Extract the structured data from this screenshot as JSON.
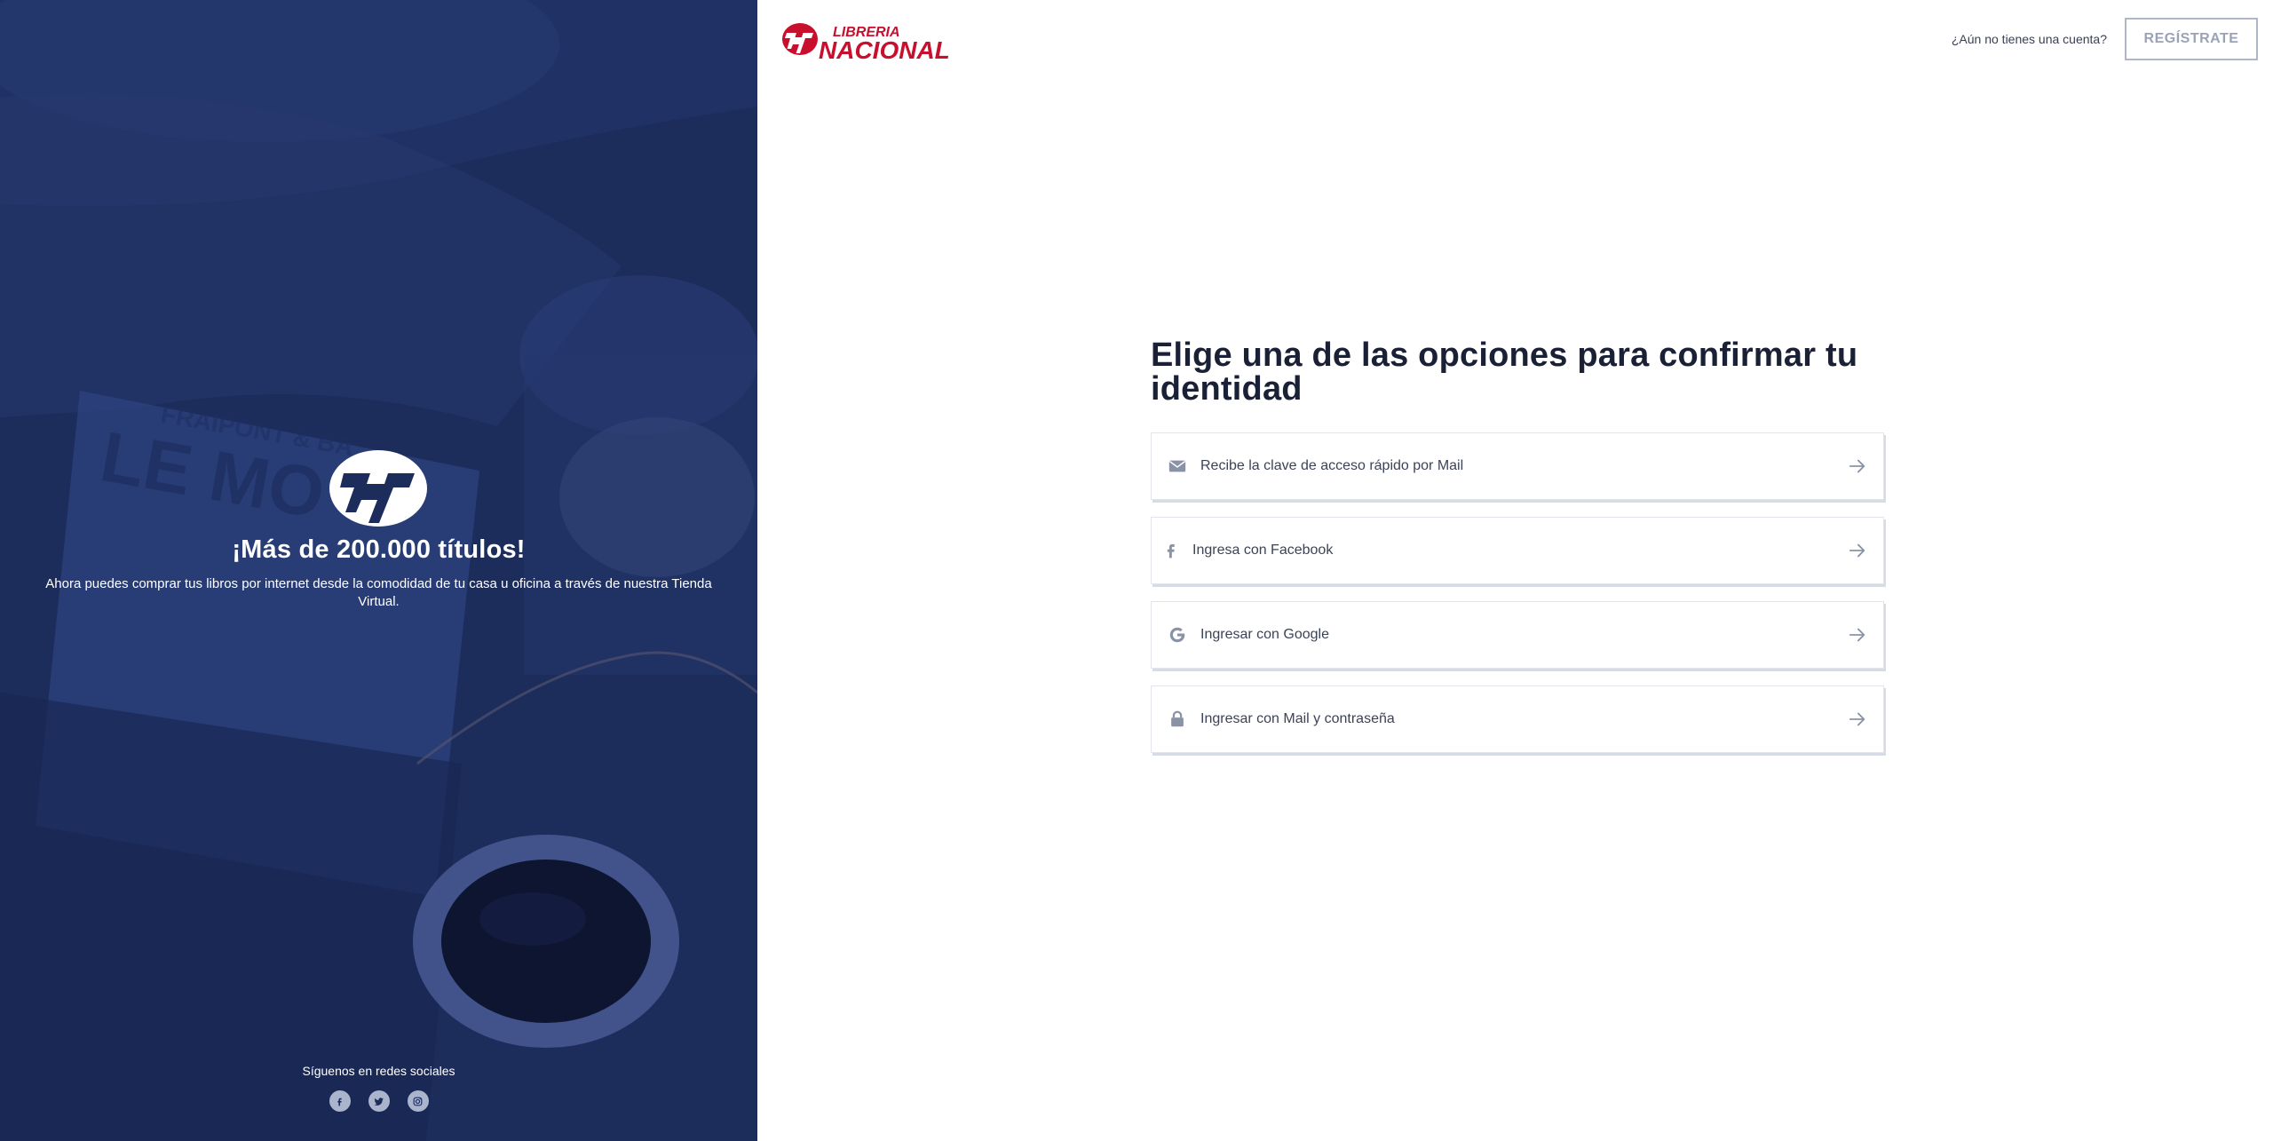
{
  "brand": {
    "logo_line1": "LIBRERIA",
    "logo_line2": "NACIONAL",
    "color": "#c8102e"
  },
  "promo": {
    "title": "¡Más de 200.000 títulos!",
    "text": "Ahora puedes comprar tus libros por internet desde la comodidad de tu casa u oficina a través de nuestra Tienda Virtual.",
    "background_color": "#1c2d5c"
  },
  "social": {
    "label": "Síguenos en redes sociales",
    "icons": [
      "facebook-icon",
      "twitter-icon",
      "instagram-icon"
    ]
  },
  "header": {
    "no_account": "¿Aún no tienes una cuenta?",
    "register_label": "REGÍSTRATE"
  },
  "auth": {
    "title": "Elige una de las opciones para confirmar tu identidad",
    "options": [
      {
        "icon": "envelope-icon",
        "label": "Recibe la clave de acceso rápido por Mail"
      },
      {
        "icon": "facebook-icon",
        "label": "Ingresa con Facebook"
      },
      {
        "icon": "google-icon",
        "label": "Ingresar con Google"
      },
      {
        "icon": "lock-icon",
        "label": "Ingresar con Mail y contraseña"
      }
    ]
  },
  "colors": {
    "heading": "#1a2136",
    "option_icon": "#8a93a6",
    "register_border": "#aeb6c7"
  }
}
